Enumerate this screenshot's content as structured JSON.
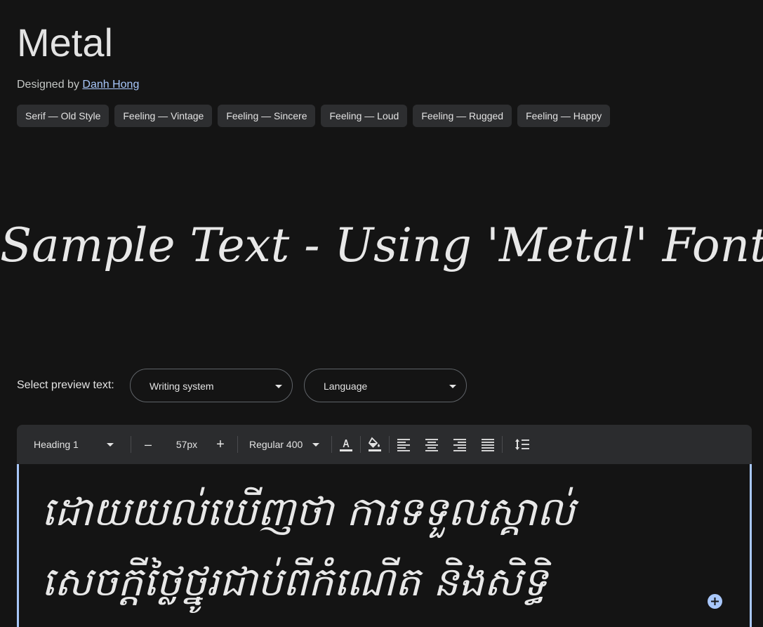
{
  "font": {
    "name": "Metal",
    "designed_by_label": "Designed by",
    "designer": "Danh Hong"
  },
  "tags": [
    "Serif — Old Style",
    "Feeling — Vintage",
    "Feeling — Sincere",
    "Feeling — Loud",
    "Feeling — Rugged",
    "Feeling — Happy"
  ],
  "sample_banner": "Sample Text - Using 'Metal' Font.",
  "preview": {
    "label": "Select preview text:",
    "writing_system": "Writing system",
    "language": "Language"
  },
  "toolbar": {
    "style": "Heading 1",
    "minus": "–",
    "size": "57px",
    "plus": "+",
    "weight": "Regular 400"
  },
  "editor_text": "ដោយយល់ឃើញថា ការទទួលស្គាល់\nសេចក្ដីថ្លៃថ្នូរជាប់ពីកំណើត និងសិទ្ធិ",
  "colors": {
    "background": "#141414",
    "chip": "#2d2e30",
    "toolbar": "#2b2c2e",
    "accent": "#a8c7fa"
  }
}
